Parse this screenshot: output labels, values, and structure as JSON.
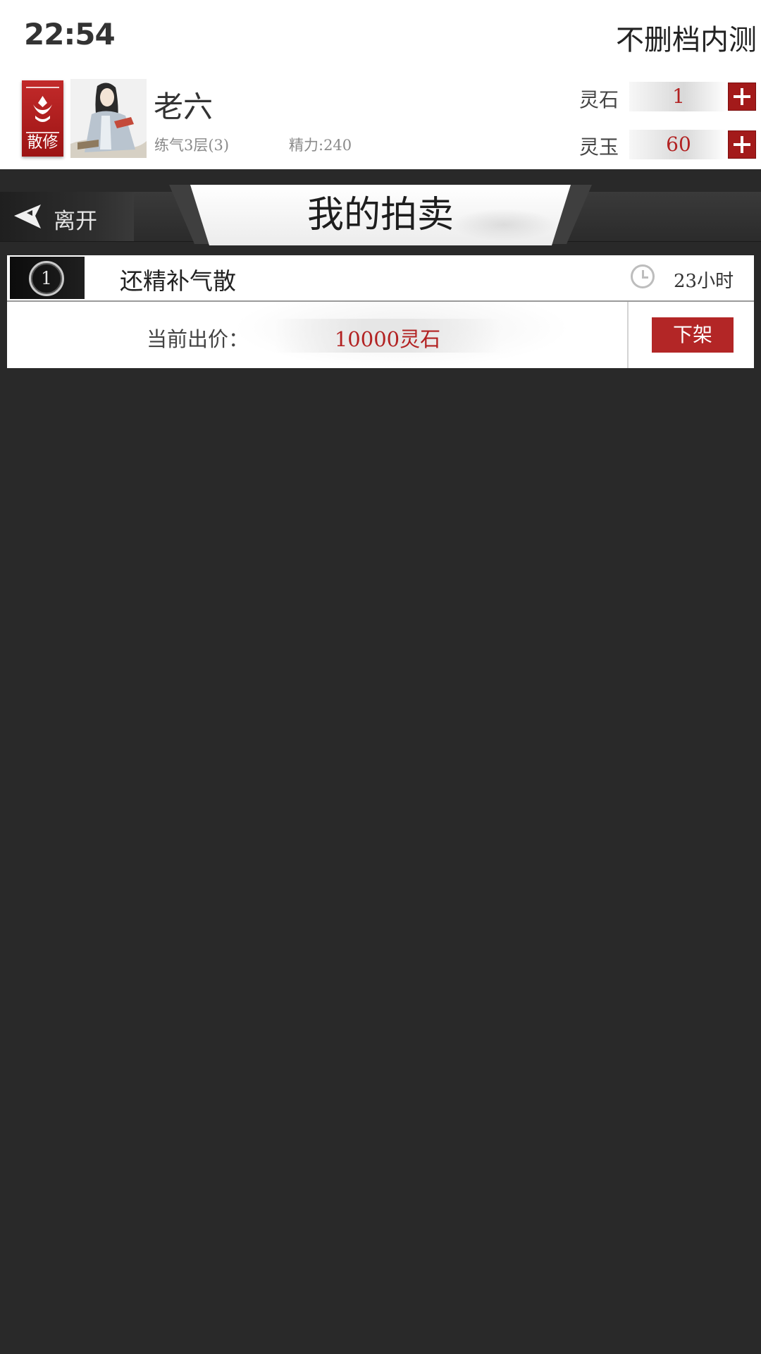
{
  "status_bar": {
    "time": "22:54",
    "title": "不删档内测"
  },
  "player": {
    "sect": "散修",
    "name": "老六",
    "level": "练气3层(3)",
    "energy": "精力:240"
  },
  "currencies": [
    {
      "label": "灵石",
      "value": "1"
    },
    {
      "label": "灵玉",
      "value": "60"
    }
  ],
  "nav": {
    "leave_label": "离开",
    "page_title": "我的拍卖"
  },
  "auctions": [
    {
      "index": "1",
      "item_name": "还精补气散",
      "time_left": "23小时",
      "price_label": "当前出价：",
      "price": "10000灵石",
      "action_label": "下架"
    }
  ],
  "colors": {
    "accent_red": "#b32626",
    "background": "#292929"
  }
}
